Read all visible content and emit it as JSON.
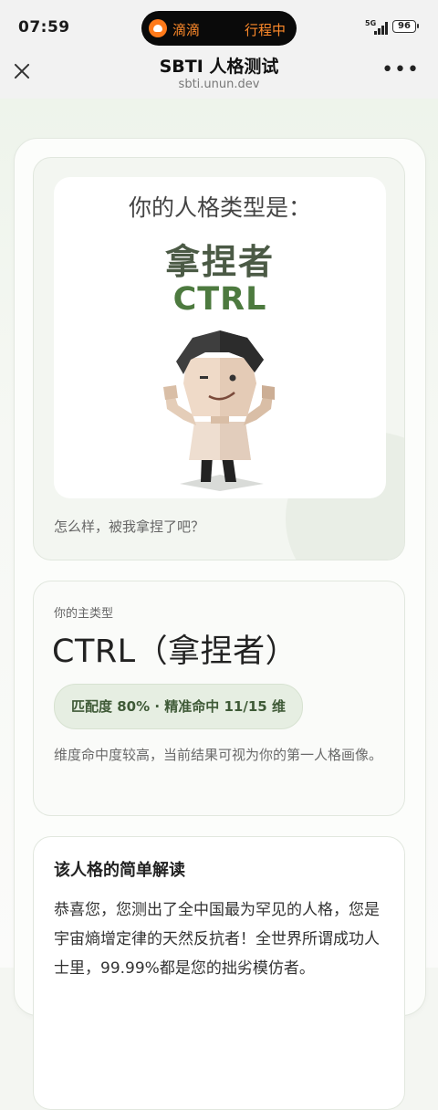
{
  "status_bar": {
    "time": "07:59",
    "pill_app": "滴滴",
    "pill_status": "行程中",
    "network": "5G",
    "battery": "96"
  },
  "nav": {
    "title": "SBTI 人格测试",
    "url": "sbti.unun.dev"
  },
  "result_card": {
    "heading": "你的人格类型是：",
    "name": "拿捏者",
    "code": "CTRL",
    "caption": "怎么样，被我拿捏了吧？"
  },
  "main_type": {
    "label": "你的主类型",
    "title": "CTRL（拿捏者）",
    "badge": "匹配度 80% · 精准命中 11/15 维",
    "description": "维度命中度较高，当前结果可视为你的第一人格画像。"
  },
  "interpretation": {
    "title": "该人格的简单解读",
    "text": "恭喜您，您测出了全中国最为罕见的人格，您是宇宙熵增定律的天然反抗者！全世界所谓成功人士里，99.99%都是您的拙劣模仿者。"
  },
  "colors": {
    "accent_green": "#4d7a3f",
    "badge_bg": "#e6eee2",
    "pill_text": "#ff8a2a"
  }
}
